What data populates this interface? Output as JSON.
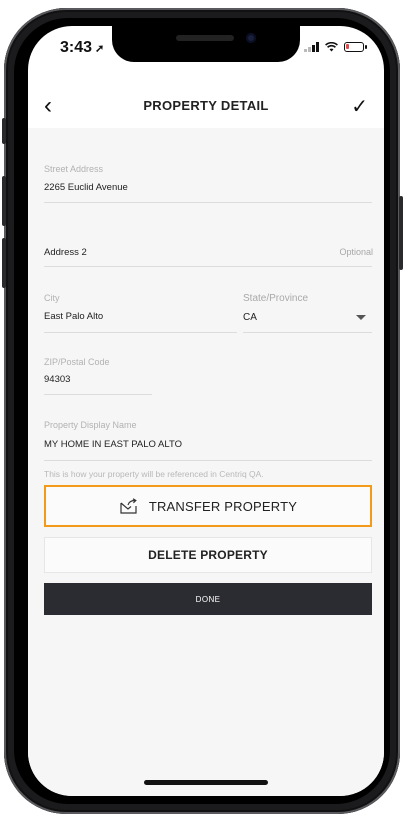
{
  "status_bar": {
    "time": "3:43",
    "location_icon": "location-arrow-icon",
    "signal_icon": "cellular-signal-icon",
    "wifi_icon": "wifi-icon",
    "battery_icon": "battery-low-icon",
    "battery_level": 0.12
  },
  "nav": {
    "back_icon": "chevron-left-icon",
    "title": "PROPERTY DETAIL",
    "done_icon": "checkmark-icon"
  },
  "form": {
    "street": {
      "label": "Street Address",
      "value": "2265 Euclid Avenue"
    },
    "address2": {
      "label": "Address 2",
      "optional": "Optional"
    },
    "city": {
      "label": "City",
      "value": "East Palo Alto"
    },
    "state": {
      "label": "State/Province",
      "value": "CA"
    },
    "zip": {
      "label": "ZIP/Postal Code",
      "value": "94303"
    },
    "display_name": {
      "label": "Property Display Name",
      "value": "MY HOME IN EAST PALO ALTO"
    },
    "helper": "This is how your property will be referenced in Centriq QA."
  },
  "actions": {
    "transfer": "TRANSFER PROPERTY",
    "delete": "DELETE PROPERTY",
    "done": "DONE"
  },
  "colors": {
    "highlight": "#f39a1a",
    "done_button": "#2b2c31",
    "background": "#f6f6f6"
  }
}
